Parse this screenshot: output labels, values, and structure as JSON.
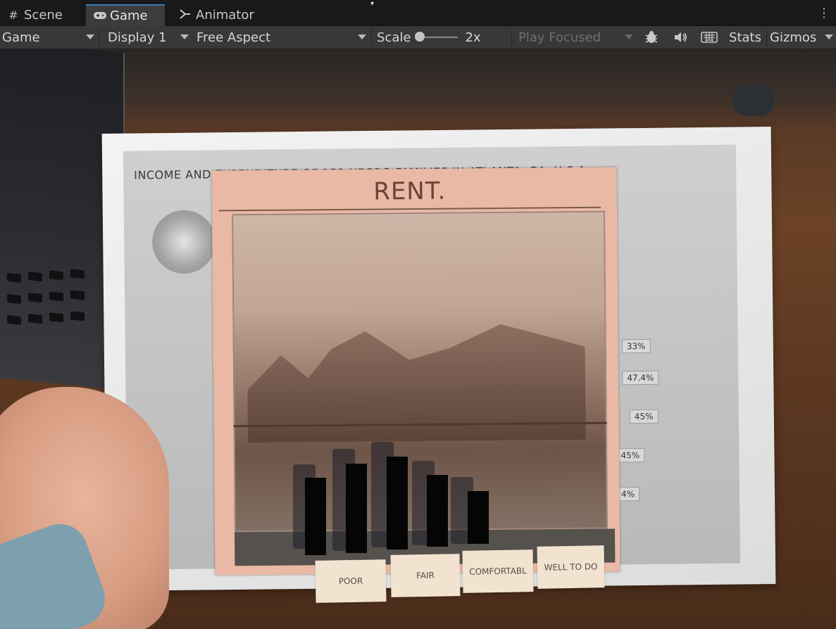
{
  "tabs": [
    {
      "label": "Scene",
      "icon": "grid-icon",
      "active": false
    },
    {
      "label": "Game",
      "icon": "gamepad-icon",
      "active": true
    },
    {
      "label": "Animator",
      "icon": "animator-icon",
      "active": false
    }
  ],
  "toolbar": {
    "view_mode": "Game",
    "display": "Display 1",
    "aspect": "Free Aspect",
    "scale_label": "Scale",
    "scale_value": "2x",
    "play_mode": "Play Focused",
    "stats_label": "Stats",
    "gizmos_label": "Gizmos"
  },
  "viewport": {
    "paper_title": "INCOME AND EXPENDITURE OF 150 NEGRO FAMILIES IN ATLANTA, GA. U.S.A.",
    "paper_percentages": [
      "33%",
      "47.4%",
      "45%",
      "45%",
      "4%"
    ],
    "ar_title": "RENT.",
    "categories": [
      "POOR",
      "FAIR",
      "COMFORTABL",
      "WELL TO DO"
    ]
  },
  "colors": {
    "accent": "#3a79bb",
    "card": "#e9b9a6",
    "bars": "#050505"
  }
}
